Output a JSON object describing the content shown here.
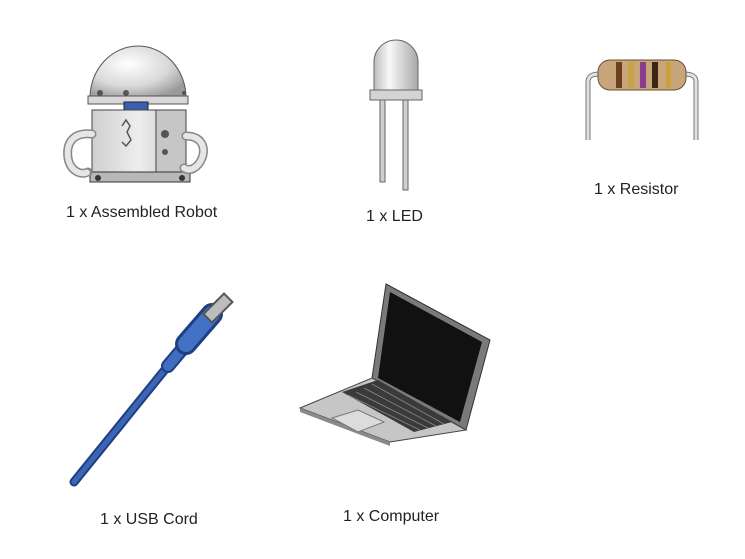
{
  "items": [
    {
      "label": "1 x Assembled Robot",
      "icon": "robot-icon"
    },
    {
      "label": "1 x LED",
      "icon": "led-icon"
    },
    {
      "label": "1 x Resistor",
      "icon": "resistor-icon"
    },
    {
      "label": "1 x USB Cord",
      "icon": "usb-cord-icon"
    },
    {
      "label": "1 x Computer",
      "icon": "laptop-icon"
    }
  ],
  "colors": {
    "text": "#222222",
    "usb_blue": "#3a66b5",
    "resistor_body": "#c8a57a",
    "screen": "#111111"
  }
}
